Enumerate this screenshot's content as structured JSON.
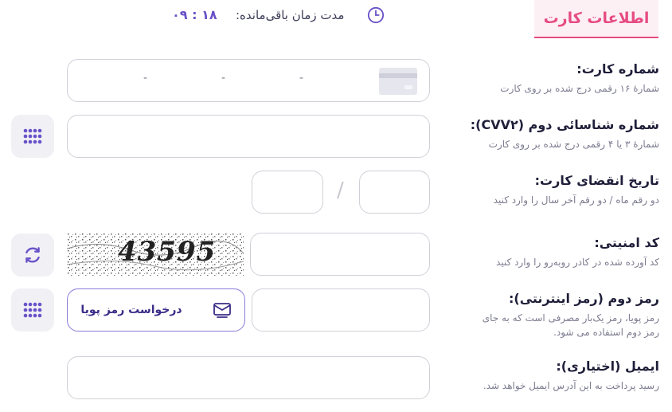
{
  "tab": {
    "label": "اطلاعات کارت"
  },
  "timer": {
    "label": "مدت زمان باقی‌مانده:",
    "value": "۰۹ : ۱۸"
  },
  "card_number": {
    "title": "شماره کارت:",
    "hint": "شمارهٔ ۱۶ رقمی درج شده بر روی کارت",
    "separators": [
      "-",
      "-",
      "-"
    ]
  },
  "cvv2": {
    "title": "شماره شناسائی دوم (CVV۲):",
    "hint": "شمارهٔ ۳ یا ۴ رقمی درج شده بر روی کارت"
  },
  "expiry": {
    "title": "تاریخ انقضای کارت:",
    "hint": "دو رقم ماه / دو رقم آخر سال را وارد کنید",
    "separator": "/"
  },
  "captcha": {
    "title": "کد امنیتی:",
    "hint": "کد آورده شده در کادر روبه‌رو را وارد کنید",
    "image_text": "43595"
  },
  "second_password": {
    "title": "رمز دوم (رمز اینترنتی):",
    "hint_line1": "رمز پویا، رمز یک‌بار مصرفی است که به جای",
    "hint_line2": "رمز دوم استفاده می شود.",
    "request_button": "درخواست رمز پویا"
  },
  "email": {
    "title": "ایمیل (اختیاری):",
    "hint": "رسید پرداخت به این آدرس ایمیل خواهد شد."
  },
  "colors": {
    "accent": "#e64c82",
    "primary": "#6a52c8",
    "border": "#d0d0d8"
  },
  "icons": [
    "clock-icon",
    "card-icon",
    "keypad-icon",
    "refresh-icon",
    "message-icon"
  ]
}
